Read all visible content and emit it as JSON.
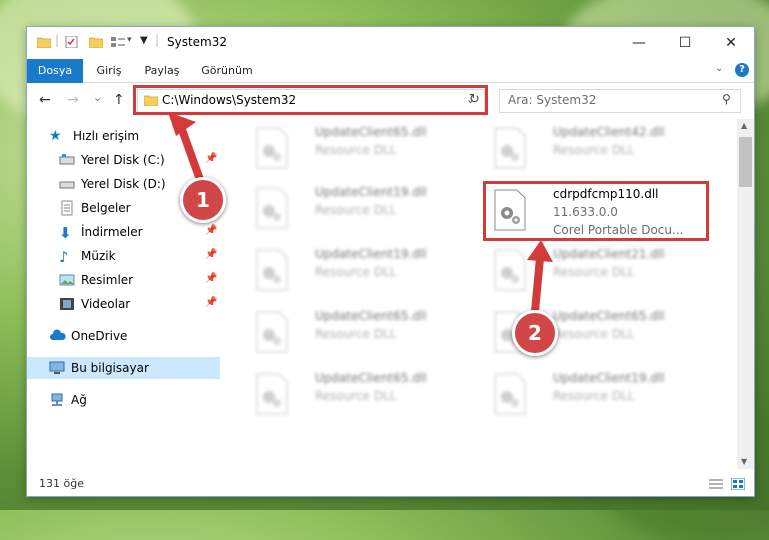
{
  "window": {
    "title": "System32",
    "minimize_glyph": "—",
    "maximize_glyph": "☐",
    "close_glyph": "✕"
  },
  "ribbon": {
    "tabs": [
      "Dosya",
      "Giriş",
      "Paylaş",
      "Görünüm"
    ],
    "help_glyph": "?"
  },
  "nav": {
    "back_glyph": "←",
    "forward_glyph": "→",
    "recent_glyph": "⌄",
    "up_glyph": "↑"
  },
  "address": {
    "path": "C:\\Windows\\System32"
  },
  "search": {
    "placeholder": "Ara: System32"
  },
  "sidebar": {
    "items": [
      {
        "label": "Hızlı erişim",
        "icon": "star-icon"
      },
      {
        "label": "Yerel Disk (C:)",
        "icon": "drive-icon"
      },
      {
        "label": "Yerel Disk (D:)",
        "icon": "drive-icon"
      },
      {
        "label": "Belgeler",
        "icon": "documents-icon"
      },
      {
        "label": "İndirmeler",
        "icon": "downloads-icon"
      },
      {
        "label": "Müzik",
        "icon": "music-icon"
      },
      {
        "label": "Resimler",
        "icon": "pictures-icon"
      },
      {
        "label": "Videolar",
        "icon": "videos-icon"
      },
      {
        "label": "OneDrive",
        "icon": "cloud-icon"
      },
      {
        "label": "Bu bilgisayar",
        "icon": "computer-icon"
      },
      {
        "label": "Ağ",
        "icon": "network-icon"
      }
    ]
  },
  "files": {
    "left_col": [
      {
        "name": "UpdateClient65.dll",
        "type": "Resource DLL"
      },
      {
        "name": "UpdateClient19.dll",
        "type": "Resource DLL"
      },
      {
        "name": "UpdateClient19.dll",
        "type": "Resource DLL"
      },
      {
        "name": "UpdateClient65.dll",
        "type": "Resource DLL"
      },
      {
        "name": "UpdateClient65.dll",
        "type": "Resource DLL"
      }
    ],
    "right_col": [
      {
        "name": "UpdateClient42.dll",
        "type": "Resource DLL"
      },
      {
        "name": "UpdateClient21.dll",
        "type": "Resource DLL"
      },
      {
        "name": "UpdateClient65.dll",
        "type": "Resource DLL"
      },
      {
        "name": "UpdateClient19.dll",
        "type": "Resource DLL"
      }
    ],
    "highlighted": {
      "name": "cdrpdfcmp110.dll",
      "version": "11.633.0.0",
      "description": "Corel Portable Docu..."
    }
  },
  "status": {
    "count": "131 öğe"
  },
  "callouts": {
    "one": "1",
    "two": "2"
  },
  "colors": {
    "accent": "#1979ca",
    "highlight": "#d33b3b",
    "selection": "#cce8ff"
  }
}
